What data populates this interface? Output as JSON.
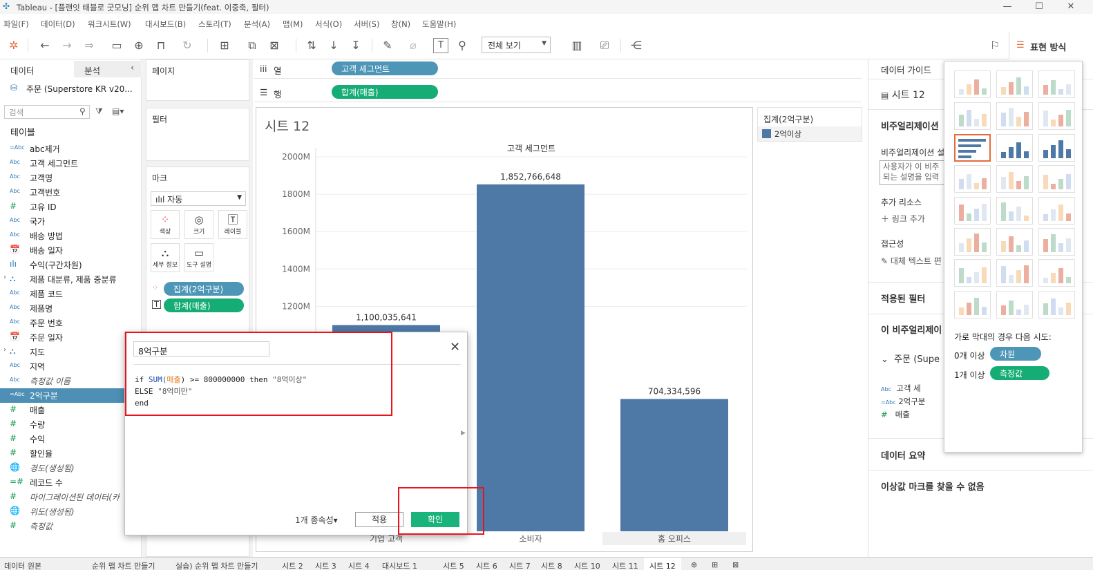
{
  "window": {
    "title": "Tableau - [플랜잇 태블로 굿모닝] 순위 맵 차트 만들기(feat. 이중축, 필터)"
  },
  "menu": [
    "파일(F)",
    "데이터(D)",
    "워크시트(W)",
    "대시보드(B)",
    "스토리(T)",
    "분석(A)",
    "맵(M)",
    "서식(O)",
    "서버(S)",
    "창(N)",
    "도움말(H)"
  ],
  "toolbar": {
    "view_select": "전체 보기",
    "showme_tab": "표현 방식"
  },
  "datapane": {
    "tab_data": "데이터",
    "tab_analysis": "분석",
    "datasource": "주문 (Superstore KR v20...",
    "search_placeholder": "검색",
    "tables_header": "테이블",
    "fields": [
      {
        "icon": "=Abc",
        "label": "abc제거"
      },
      {
        "icon": "Abc",
        "label": "고객 세그먼트"
      },
      {
        "icon": "Abc",
        "label": "고객명"
      },
      {
        "icon": "Abc",
        "label": "고객번호"
      },
      {
        "icon": "#",
        "label": "고유 ID"
      },
      {
        "icon": "Abc",
        "label": "국가"
      },
      {
        "icon": "Abc",
        "label": "배송 방법"
      },
      {
        "icon": "📅",
        "label": "배송 일자"
      },
      {
        "icon": "ılı",
        "label": "수익(구간차원)"
      },
      {
        "icon": "⛬",
        "label": "제품 대분류, 제품 중분류"
      },
      {
        "icon": "Abc",
        "label": "제품 코드"
      },
      {
        "icon": "Abc",
        "label": "제품명"
      },
      {
        "icon": "Abc",
        "label": "주문 번호"
      },
      {
        "icon": "📅",
        "label": "주문 일자"
      },
      {
        "icon": "⛬",
        "label": "지도"
      },
      {
        "icon": "Abc",
        "label": "지역"
      },
      {
        "icon": "Abc",
        "label": "측정값 이름"
      },
      {
        "icon": "=Abc",
        "label": "2억구분"
      },
      {
        "icon": "#",
        "label": "매출"
      },
      {
        "icon": "#",
        "label": "수량"
      },
      {
        "icon": "#",
        "label": "수익"
      },
      {
        "icon": "#",
        "label": "할인율"
      },
      {
        "icon": "🌐",
        "label": "경도(생성됨)"
      },
      {
        "icon": "=#",
        "label": "레코드 수"
      },
      {
        "icon": "#",
        "label": "마이그레이션된 데이터(카"
      },
      {
        "icon": "🌐",
        "label": "위도(생성됨)"
      },
      {
        "icon": "#",
        "label": "측정값"
      }
    ]
  },
  "shelves": {
    "pages": "페이지",
    "filters": "필터",
    "marks": "마크",
    "mark_type": "자동",
    "mark_buttons": [
      "색상",
      "크기",
      "레이블",
      "세부 정보",
      "도구 설명"
    ],
    "mark_pills": [
      "집계(2억구분)",
      "합계(매출)"
    ],
    "columns_label": "열",
    "rows_label": "행",
    "columns_pill": "고객 세그먼트",
    "rows_pill": "합계(매출)"
  },
  "sheet": {
    "title": "시트 12",
    "header": "고객 세그먼트"
  },
  "legend": {
    "title": "집계(2억구분)",
    "item": "2억이상",
    "color": "#4e79a7"
  },
  "chart_data": {
    "type": "bar",
    "categories": [
      "기업 고객",
      "소비자",
      "홈 오피스"
    ],
    "values": [
      1100035641,
      1852766648,
      704334596
    ],
    "value_labels": [
      "1,100,035,641",
      "1,852,766,648",
      "704,334,596"
    ],
    "y_ticks": [
      "2000M",
      "1800M",
      "1600M",
      "1400M",
      "1200M"
    ],
    "ylim": [
      0,
      2000000000
    ],
    "xlabel": "고객 세그먼트",
    "bar_color": "#4e79a7"
  },
  "guide": {
    "tab": "데이터 가이드",
    "sheet": "시트 12",
    "viz_section": "비주얼리제이션",
    "viz_desc": "비주얼리제이션 설",
    "desc_box": [
      "사용자가 이 비주",
      "되는 설명을 입력"
    ],
    "resources": "추가 리소스",
    "add_link": "링크 추가",
    "accessibility": "접근성",
    "alt_text": "대체 텍스트 편",
    "applied_filters": "적용된 필터",
    "this_viz": "이 비주얼리제이",
    "datasource": "주문 (Supe",
    "fields": [
      "고객 세",
      "2억구분",
      "매출"
    ],
    "summary": "데이터 요약",
    "no_outliers": "이상값 마크를 찾을 수 없음"
  },
  "showme": {
    "hint": "가로 막대의 경우 다음 시도:",
    "dims": "0개 이상",
    "dims_pill": "차원",
    "meas": "1개 이상",
    "meas_pill": "측정값"
  },
  "calc": {
    "name": "8억구분",
    "line1": {
      "pre": "if ",
      "fn": "SUM(",
      "field": "매출",
      "post": ") >= 800000000 then ",
      "str": "\"8억이상\""
    },
    "line2": {
      "pre": "ELSE ",
      "str": "\"8억미만\""
    },
    "line3": "end",
    "dependencies": "1개 종속성",
    "apply": "적용",
    "ok": "확인"
  },
  "tabs": [
    "데이터 원본",
    "순위 맵 차트 만들기",
    "실습) 순위 맵 차트 만들기",
    "시트 2",
    "시트 3",
    "시트 4",
    "대시보드 1",
    "시트 5",
    "시트 6",
    "시트 7",
    "시트 8",
    "시트 10",
    "시트 11",
    "시트 12"
  ]
}
